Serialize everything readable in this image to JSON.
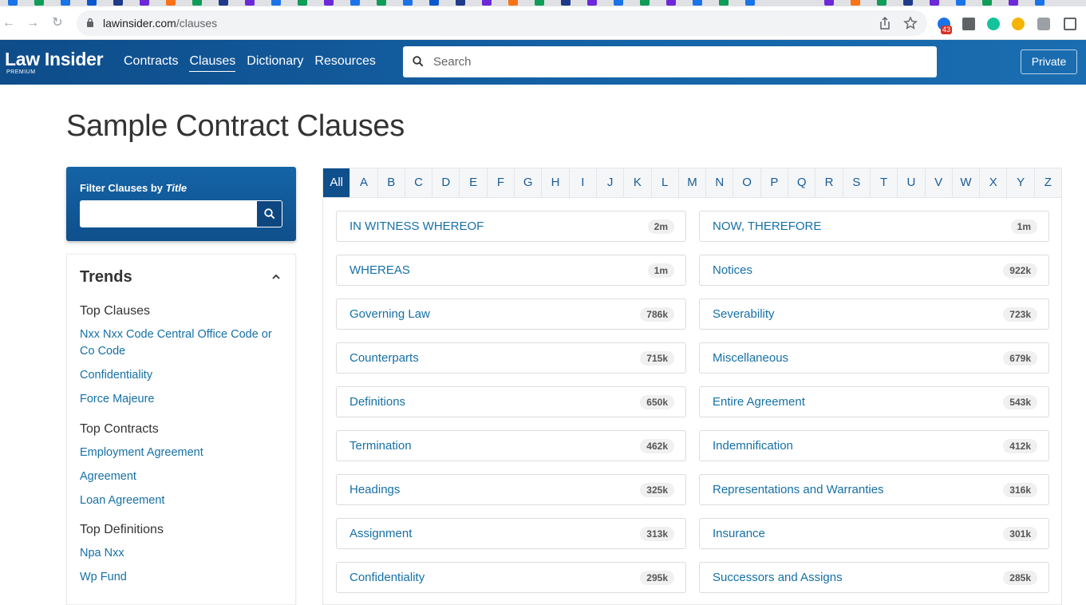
{
  "browser": {
    "url_host": "lawinsider.com",
    "url_path": "/clauses",
    "extension_badge": "43"
  },
  "site": {
    "logo_name": "Law Insider",
    "logo_tier": "PREMIUM",
    "nav": [
      "Contracts",
      "Clauses",
      "Dictionary",
      "Resources"
    ],
    "active_nav": "Clauses",
    "search_placeholder": "Search",
    "private_label": "Private"
  },
  "page": {
    "title": "Sample Contract Clauses"
  },
  "filter": {
    "label_prefix": "Filter Clauses by",
    "label_emphasis": "Title",
    "value": ""
  },
  "trends": {
    "heading": "Trends",
    "groups": [
      {
        "head": "Top Clauses",
        "items": [
          "Nxx Nxx Code Central Office Code or Co Code",
          "Confidentiality",
          "Force Majeure"
        ]
      },
      {
        "head": "Top Contracts",
        "items": [
          "Employment Agreement",
          "Agreement",
          "Loan Agreement"
        ]
      },
      {
        "head": "Top Definitions",
        "items": [
          "Npa Nxx",
          "Wp Fund"
        ]
      }
    ]
  },
  "alphabet": {
    "letters": [
      "All",
      "A",
      "B",
      "C",
      "D",
      "E",
      "F",
      "G",
      "H",
      "I",
      "J",
      "K",
      "L",
      "M",
      "N",
      "O",
      "P",
      "Q",
      "R",
      "S",
      "T",
      "U",
      "V",
      "W",
      "X",
      "Y",
      "Z"
    ],
    "active": "All"
  },
  "clauses": [
    {
      "title": "IN WITNESS WHEREOF",
      "count": "2m"
    },
    {
      "title": "NOW, THEREFORE",
      "count": "1m"
    },
    {
      "title": "WHEREAS",
      "count": "1m"
    },
    {
      "title": "Notices",
      "count": "922k"
    },
    {
      "title": "Governing Law",
      "count": "786k"
    },
    {
      "title": "Severability",
      "count": "723k"
    },
    {
      "title": "Counterparts",
      "count": "715k"
    },
    {
      "title": "Miscellaneous",
      "count": "679k"
    },
    {
      "title": "Definitions",
      "count": "650k"
    },
    {
      "title": "Entire Agreement",
      "count": "543k"
    },
    {
      "title": "Termination",
      "count": "462k"
    },
    {
      "title": "Indemnification",
      "count": "412k"
    },
    {
      "title": "Headings",
      "count": "325k"
    },
    {
      "title": "Representations and Warranties",
      "count": "316k"
    },
    {
      "title": "Assignment",
      "count": "313k"
    },
    {
      "title": "Insurance",
      "count": "301k"
    },
    {
      "title": "Confidentiality",
      "count": "295k"
    },
    {
      "title": "Successors and Assigns",
      "count": "285k"
    }
  ],
  "colors": {
    "brand": "#0f4f8c",
    "link": "#1570a6"
  }
}
